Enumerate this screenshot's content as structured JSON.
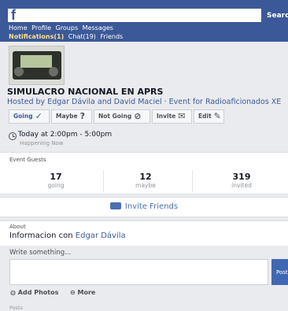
{
  "header": {
    "logo": "f",
    "search_placeholder": "",
    "search_label": "Search",
    "nav_primary": [
      "Home",
      "Profile",
      "Groups",
      "Messages"
    ],
    "nav_secondary": [
      "Notifications(1)",
      "Chat(19)",
      "Friends"
    ]
  },
  "event": {
    "title": "SIMULACRO NACIONAL EN APRS",
    "hosted_by": "Hosted by Edgar Dávila and David Maciel · Event for Radioaficionados XE",
    "actions": {
      "going": "Going",
      "maybe": "Maybe",
      "not_going": "Not Going",
      "invite": "Invite",
      "edit": "Edit"
    },
    "time": "Today at 2:00pm - 5:00pm",
    "time_status": "Happening Now"
  },
  "guests": {
    "title": "Event Guests",
    "going": {
      "count": "17",
      "label": "going"
    },
    "maybe": {
      "count": "12",
      "label": "maybe"
    },
    "invited": {
      "count": "319",
      "label": "invited"
    }
  },
  "invite_friends": "Invite Friends",
  "about": {
    "title": "About",
    "text": "Informacion con",
    "link": "Edgar Dávila"
  },
  "composer": {
    "label": "Write something...",
    "input_value": "",
    "post_label": "Post",
    "add_photos": "Add Photos",
    "more": "More"
  },
  "posts_title": "Posts",
  "colors": {
    "brand": "#3b5998",
    "background": "#e9ebee",
    "notification": "#ffe08a",
    "link": "#3b5998"
  },
  "icons": [
    "check-icon",
    "question-icon",
    "prohibited-icon",
    "mail-icon",
    "pencil-icon",
    "clock-icon",
    "invite-friends-icon",
    "camera-icon",
    "more-icon"
  ]
}
